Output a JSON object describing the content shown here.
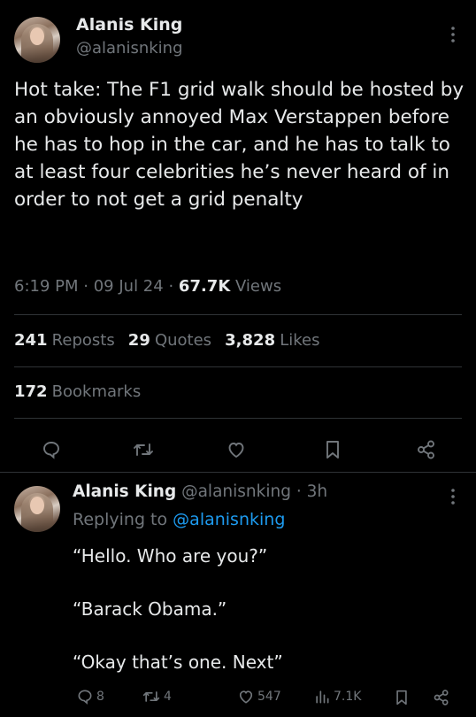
{
  "main_tweet": {
    "author_name": "Alanis King",
    "author_handle": "@alanisnking",
    "text": "Hot take: The F1 grid walk should be hosted by an obviously annoyed Max Verstappen before he has to hop in the car, and he has to talk to at least four celebrities he’s never heard of in order to not get a grid penalty",
    "time": "6:19 PM",
    "date": "09 Jul 24",
    "sep": "·",
    "views_count": "67.7K",
    "views_label": "Views",
    "reposts_count": "241",
    "reposts_label": "Reposts",
    "quotes_count": "29",
    "quotes_label": "Quotes",
    "likes_count": "3,828",
    "likes_label": "Likes",
    "bookmarks_count": "172",
    "bookmarks_label": "Bookmarks"
  },
  "reply": {
    "author_name": "Alanis King",
    "author_handle": "@alanisnking",
    "age": "3h",
    "sep": "·",
    "replying_prefix": "Replying to",
    "replying_handle": "@alanisnking",
    "line1": "“Hello. Who are you?”",
    "line2": "“Barack Obama.”",
    "line3": "“Okay that’s one. Next”",
    "replies": "8",
    "reposts": "4",
    "likes": "547",
    "views": "7.1K"
  },
  "icons": {
    "more": "more-icon",
    "reply": "reply-icon",
    "repost": "repost-icon",
    "like": "heart-icon",
    "bookmark": "bookmark-icon",
    "share": "share-icon",
    "views": "views-icon"
  },
  "colors": {
    "background": "#000000",
    "text": "#e7e9ea",
    "muted": "#71767b",
    "link": "#1d9bf0",
    "divider": "#2f3336"
  }
}
